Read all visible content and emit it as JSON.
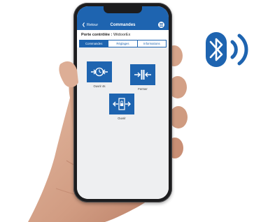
{
  "app": {
    "back_label": "Retour",
    "title": "Commandes",
    "device_label": "Porte contrôlée :",
    "device_name": "WidoorEx"
  },
  "tabs": [
    {
      "label": "Commandes",
      "active": true
    },
    {
      "label": "Réglages",
      "active": false
    },
    {
      "label": "Informations",
      "active": false
    }
  ],
  "commands": [
    {
      "label": "Ouvrir 4s",
      "icon": "door-open-timer-icon"
    },
    {
      "label": "Fermer",
      "icon": "door-close-icon"
    },
    {
      "label": "Ouvrir",
      "icon": "door-unlock-icon"
    }
  ],
  "colors": {
    "accent": "#1e64b0",
    "bluetooth": "#1e64b0",
    "background": "#eeeff1"
  },
  "decor": {
    "bluetooth_icon": "bluetooth-icon"
  }
}
